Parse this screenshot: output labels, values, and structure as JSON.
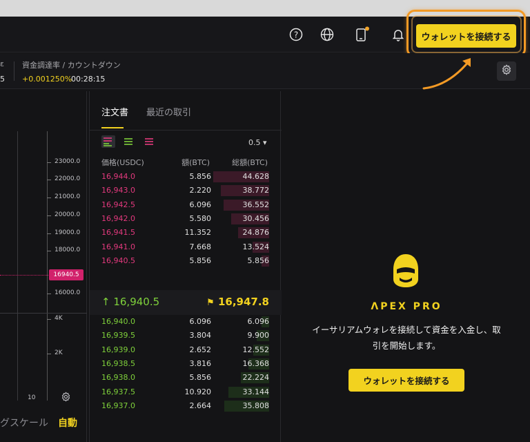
{
  "header": {
    "connect_button": "ウォレットを接続する",
    "icons": [
      "help-icon",
      "globe-icon",
      "mobile-icon",
      "bell-icon"
    ]
  },
  "infobar": {
    "funding_label": "資金調達率 / カウントダウン",
    "funding_rate": "+0.001250%",
    "countdown": "00:28:15",
    "left_label_fragment": "ɛ",
    "left_value_fragment": "5"
  },
  "chart": {
    "y_ticks": [
      "23000.0",
      "22000.0",
      "21000.0",
      "20000.0",
      "19000.0",
      "18000.0",
      "16940.5",
      "16000.0",
      "4K",
      "2K"
    ],
    "price_tag": "16940.5",
    "x_tick": "10",
    "scale_label": "グスケール",
    "auto_label": "自動"
  },
  "orderbook": {
    "tabs": [
      "注文書",
      "最近の取引"
    ],
    "precision": "0.5 ▾",
    "columns": {
      "price": "価格(USDC)",
      "amount": "額(BTC)",
      "total": "総額(BTC)"
    },
    "asks": [
      {
        "price": "16,944.0",
        "amount": "5.856",
        "total": "44.628",
        "depth": 0.6
      },
      {
        "price": "16,943.0",
        "amount": "2.220",
        "total": "38.772",
        "depth": 0.52
      },
      {
        "price": "16,942.5",
        "amount": "6.096",
        "total": "36.552",
        "depth": 0.49
      },
      {
        "price": "16,942.0",
        "amount": "5.580",
        "total": "30.456",
        "depth": 0.41
      },
      {
        "price": "16,941.5",
        "amount": "11.352",
        "total": "24.876",
        "depth": 0.33
      },
      {
        "price": "16,941.0",
        "amount": "7.668",
        "total": "13.524",
        "depth": 0.18
      },
      {
        "price": "16,940.5",
        "amount": "5.856",
        "total": "5.856",
        "depth": 0.08
      }
    ],
    "mid": {
      "last_price": "↑ 16,940.5",
      "mark_price": "16,947.8"
    },
    "bids": [
      {
        "price": "16,940.0",
        "amount": "6.096",
        "total": "6.096",
        "depth": 0.08
      },
      {
        "price": "16,939.5",
        "amount": "3.804",
        "total": "9.900",
        "depth": 0.13
      },
      {
        "price": "16,939.0",
        "amount": "2.652",
        "total": "12.552",
        "depth": 0.17
      },
      {
        "price": "16,938.5",
        "amount": "3.816",
        "total": "16.368",
        "depth": 0.22
      },
      {
        "price": "16,938.0",
        "amount": "5.856",
        "total": "22.224",
        "depth": 0.3
      },
      {
        "price": "16,937.5",
        "amount": "10.920",
        "total": "33.144",
        "depth": 0.44
      },
      {
        "price": "16,937.0",
        "amount": "2.664",
        "total": "35.808",
        "depth": 0.48
      }
    ]
  },
  "connect_panel": {
    "brand": "ΛPEX PRO",
    "description_line1": "イーサリアムウォレを接続して資金を入金し、取",
    "description_line2": "引を開始します。",
    "button": "ウォレットを接続する"
  },
  "colors": {
    "accent": "#f2d21f",
    "ask": "#e4397e",
    "bid": "#7fd13b",
    "highlight": "#f39a25"
  }
}
